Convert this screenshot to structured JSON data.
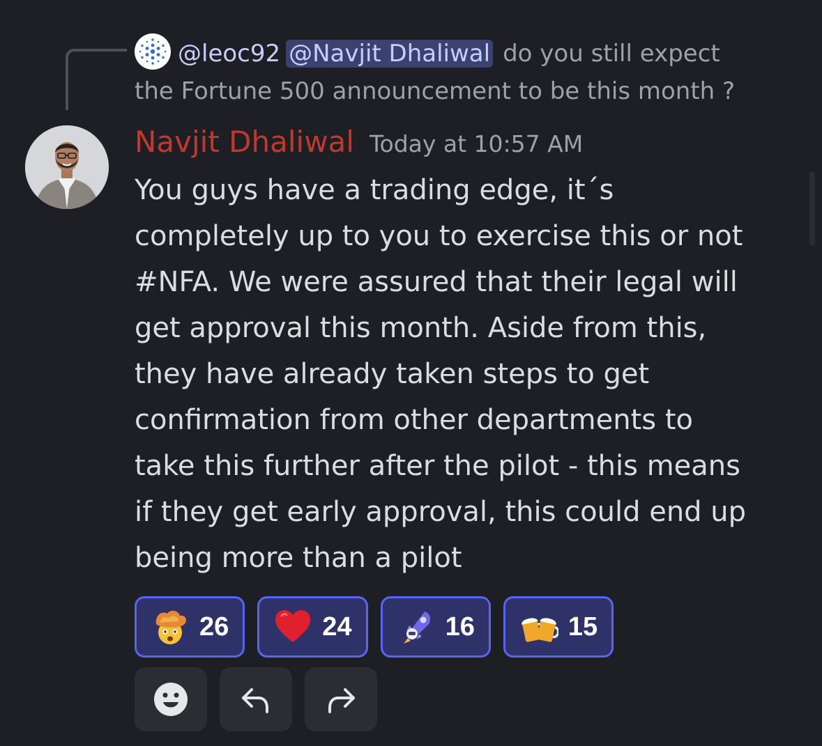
{
  "reply": {
    "username": "@leoc92",
    "mention": "@Navjit Dhaliwal",
    "text_line1": "do you still expect",
    "text_line2": "the Fortune 500 announcement to be this month ?"
  },
  "message": {
    "author": "Navjit Dhaliwal",
    "timestamp": "Today at 10:57 AM",
    "lines": [
      "You guys have a trading edge, it´s",
      "completely up to you to exercise this or not",
      "#NFA. We were assured that their legal will",
      "get approval this month. Aside from this,",
      "they have already taken steps to get",
      "confirmation from other departments to",
      "take this further after the pilot - this means",
      "if they get early approval, this could end up",
      "being more than a pilot"
    ]
  },
  "reactions": [
    {
      "emoji": "exploding-head-icon",
      "count": "26"
    },
    {
      "emoji": "red-heart-icon",
      "count": "24"
    },
    {
      "emoji": "astronaut-rocket-icon",
      "count": "16"
    },
    {
      "emoji": "beer-mugs-icon",
      "count": "15"
    }
  ],
  "actions": [
    {
      "icon": "add-reaction-icon"
    },
    {
      "icon": "reply-icon"
    },
    {
      "icon": "forward-icon"
    }
  ],
  "colors": {
    "author": "#c0392b",
    "mention_bg": "#3c4270",
    "reaction_border": "#5865f2",
    "reaction_bg": "#2e3269"
  }
}
